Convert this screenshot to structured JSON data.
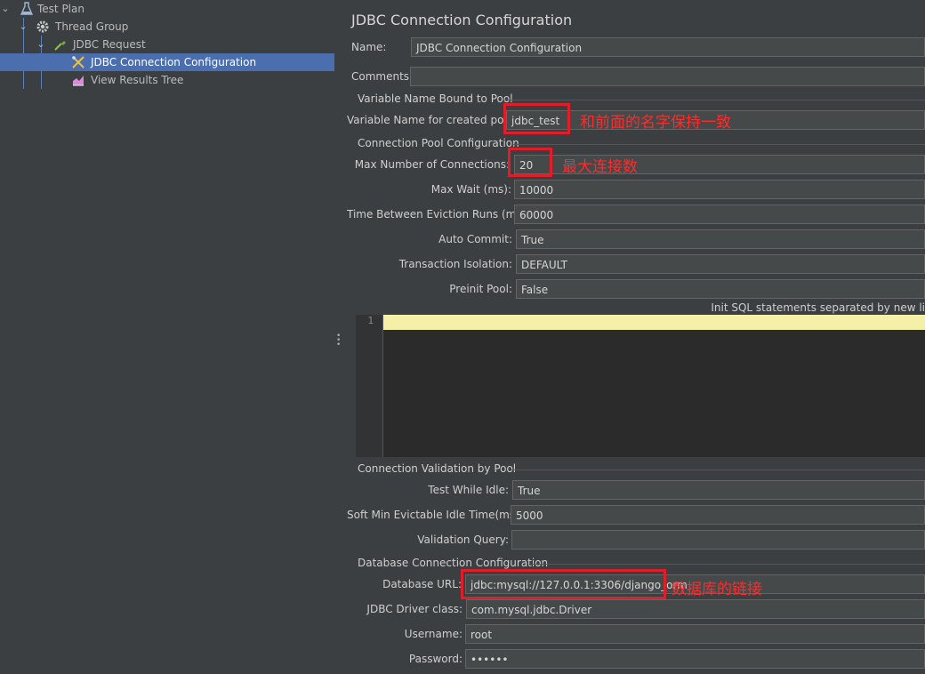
{
  "tree": {
    "items": [
      {
        "label": "Test Plan"
      },
      {
        "label": "Thread Group"
      },
      {
        "label": "JDBC Request"
      },
      {
        "label": "JDBC Connection Configuration"
      },
      {
        "label": "View Results Tree"
      }
    ]
  },
  "panel": {
    "title": "JDBC Connection Configuration",
    "name_label": "Name:",
    "name_value": "JDBC Connection Configuration",
    "comments_label": "Comments:",
    "comments_value": "",
    "group_pool": "Variable Name Bound to Pool",
    "var_name_label": "Variable Name for created pool:",
    "var_name_value": "jdbc_test",
    "group_conn_pool": "Connection Pool Configuration",
    "max_conn_label": "Max Number of Connections:",
    "max_conn_value": "20",
    "max_wait_label": "Max Wait (ms):",
    "max_wait_value": "10000",
    "eviction_label": "Time Between Eviction Runs (ms):",
    "eviction_value": "60000",
    "auto_commit_label": "Auto Commit:",
    "auto_commit_value": "True",
    "isolation_label": "Transaction Isolation:",
    "isolation_value": "DEFAULT",
    "preinit_label": "Preinit Pool:",
    "preinit_value": "False",
    "init_sql_hint": "Init SQL statements separated by new li",
    "editor_line": "1",
    "group_validation": "Connection Validation by Pool",
    "test_idle_label": "Test While Idle:",
    "test_idle_value": "True",
    "soft_min_label": "Soft Min Evictable Idle Time(ms):",
    "soft_min_value": "5000",
    "validation_query_label": "Validation Query:",
    "validation_query_value": "",
    "group_db": "Database Connection Configuration",
    "db_url_label": "Database URL:",
    "db_url_value": "jdbc:mysql://127.0.0.1:3306/django_orm",
    "driver_label": "JDBC Driver class:",
    "driver_value": "com.mysql.jdbc.Driver",
    "username_label": "Username:",
    "username_value": "root",
    "password_label": "Password:",
    "password_value": "••••••"
  },
  "annotations": {
    "pool_note": "和前面的名字保持一致",
    "max_conn_note": "最大连接数",
    "db_url_note": "数据库的链接"
  },
  "colors": {
    "accent_selected": "#4b6eaf",
    "annotation": "#e11d2a"
  }
}
